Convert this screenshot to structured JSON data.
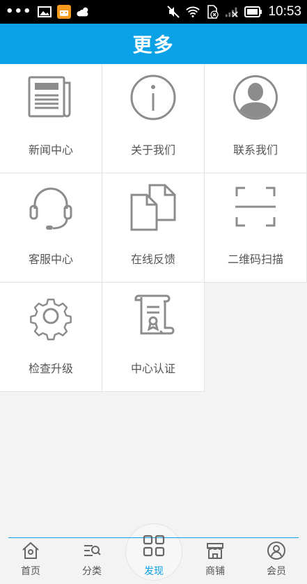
{
  "status_bar": {
    "time": "10:53"
  },
  "header": {
    "title": "更多"
  },
  "grid": {
    "items": [
      {
        "label": "新闻中心",
        "icon": "newspaper-icon"
      },
      {
        "label": "关于我们",
        "icon": "info-icon"
      },
      {
        "label": "联系我们",
        "icon": "contact-person-icon"
      },
      {
        "label": "客服中心",
        "icon": "headset-icon"
      },
      {
        "label": "在线反馈",
        "icon": "documents-icon"
      },
      {
        "label": "二维码扫描",
        "icon": "scan-icon"
      },
      {
        "label": "检查升级",
        "icon": "gear-icon"
      },
      {
        "label": "中心认证",
        "icon": "certificate-icon"
      }
    ]
  },
  "tabbar": {
    "tabs": [
      {
        "label": "首页",
        "icon": "home-icon"
      },
      {
        "label": "分类",
        "icon": "category-icon"
      },
      {
        "label": "发现",
        "icon": "discover-grid-icon"
      },
      {
        "label": "商铺",
        "icon": "shop-icon"
      },
      {
        "label": "会员",
        "icon": "member-icon"
      }
    ],
    "active_index": 2
  },
  "colors": {
    "accent": "#0aa1e6",
    "icon_gray": "#8c8c8c"
  }
}
